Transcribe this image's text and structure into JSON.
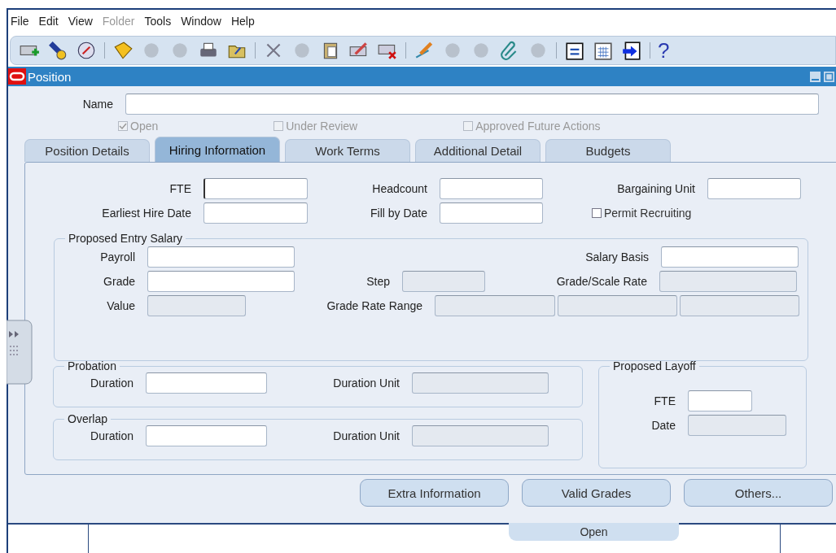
{
  "menu": [
    {
      "label": "File",
      "disabled": false
    },
    {
      "label": "Edit",
      "disabled": false
    },
    {
      "label": "View",
      "disabled": false
    },
    {
      "label": "Folder",
      "disabled": true
    },
    {
      "label": "Tools",
      "disabled": false
    },
    {
      "label": "Window",
      "disabled": false
    },
    {
      "label": "Help",
      "disabled": false
    }
  ],
  "toolbar": {
    "help_glyph": "?"
  },
  "window": {
    "title": "Position"
  },
  "name_field": {
    "label": "Name"
  },
  "checkboxes": [
    {
      "label": "Open",
      "checked": true,
      "disabled": true
    },
    {
      "label": "Under Review",
      "checked": false,
      "disabled": true
    },
    {
      "label": "Approved Future Actions",
      "checked": false,
      "disabled": true
    }
  ],
  "tabs": [
    {
      "label": "Position Details",
      "selected": false
    },
    {
      "label": "Hiring Information",
      "selected": true
    },
    {
      "label": "Work Terms",
      "selected": false
    },
    {
      "label": "Additional Detail",
      "selected": false
    },
    {
      "label": "Budgets",
      "selected": false
    }
  ],
  "top_fields": [
    {
      "label": "FTE",
      "focused": true
    },
    {
      "label": "Headcount",
      "focused": false
    },
    {
      "label": "Bargaining Unit",
      "focused": false
    },
    {
      "label": "Earliest Hire Date",
      "focused": false
    },
    {
      "label": "Fill by Date",
      "focused": false
    }
  ],
  "permit_recruiting": {
    "label": "Permit Recruiting",
    "checked": false
  },
  "entry_salary": {
    "title": "Proposed Entry Salary",
    "payroll": {
      "label": "Payroll",
      "disabled": false
    },
    "salary_basis": {
      "label": "Salary Basis",
      "disabled": false
    },
    "grade": {
      "label": "Grade",
      "disabled": false
    },
    "step": {
      "label": "Step",
      "disabled": true
    },
    "grade_scale_rate": {
      "label": "Grade/Scale Rate",
      "disabled": true
    },
    "value": {
      "label": "Value",
      "disabled": true
    },
    "grade_rate_range": {
      "label": "Grade Rate Range",
      "disabled": true
    }
  },
  "probation": {
    "title": "Probation",
    "duration": {
      "label": "Duration",
      "disabled": false
    },
    "duration_unit": {
      "label": "Duration Unit",
      "disabled": true
    }
  },
  "overlap": {
    "title": "Overlap",
    "duration": {
      "label": "Duration",
      "disabled": false
    },
    "duration_unit": {
      "label": "Duration Unit",
      "disabled": true
    }
  },
  "proposed_layoff": {
    "title": "Proposed Layoff",
    "fte": {
      "label": "FTE",
      "disabled": false
    },
    "date": {
      "label": "Date",
      "disabled": true
    }
  },
  "buttons": [
    "Extra Information",
    "Valid Grades",
    "Others..."
  ],
  "background_button": "Open"
}
